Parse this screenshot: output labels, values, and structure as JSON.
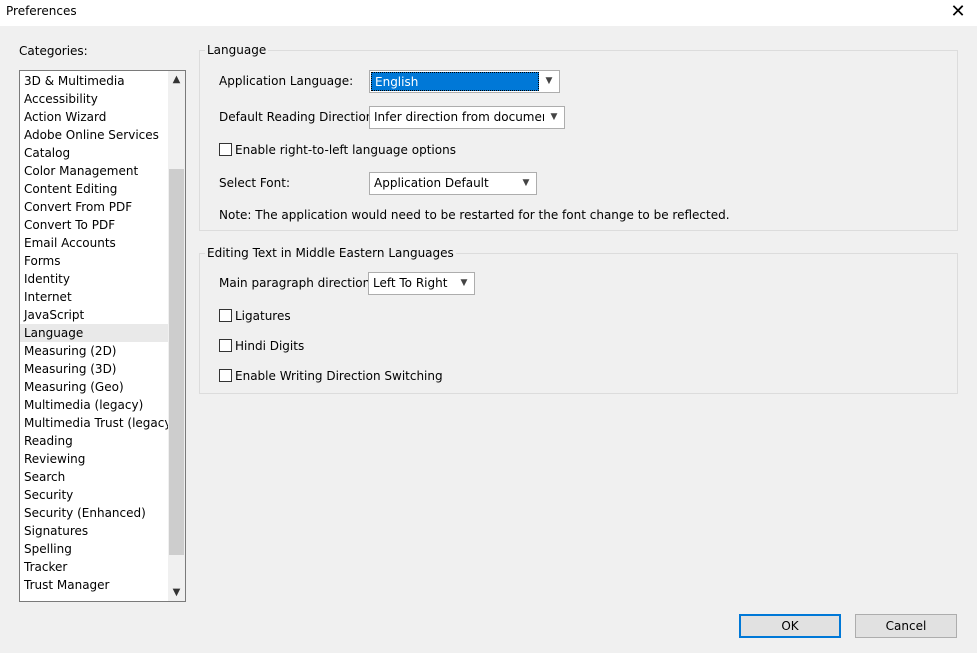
{
  "window": {
    "title": "Preferences",
    "close_glyph": "✕"
  },
  "categories": {
    "label": "Categories:",
    "items": [
      "3D & Multimedia",
      "Accessibility",
      "Action Wizard",
      "Adobe Online Services",
      "Catalog",
      "Color Management",
      "Content Editing",
      "Convert From PDF",
      "Convert To PDF",
      "Email Accounts",
      "Forms",
      "Identity",
      "Internet",
      "JavaScript",
      "Language",
      "Measuring (2D)",
      "Measuring (3D)",
      "Measuring (Geo)",
      "Multimedia (legacy)",
      "Multimedia Trust (legacy)",
      "Reading",
      "Reviewing",
      "Search",
      "Security",
      "Security (Enhanced)",
      "Signatures",
      "Spelling",
      "Tracker",
      "Trust Manager"
    ],
    "selected": "Language"
  },
  "language_group": {
    "title": "Language",
    "app_language_label": "Application Language:",
    "app_language_value": "English",
    "reading_direction_label": "Default Reading Direction:",
    "reading_direction_value": "Infer direction from document",
    "rtl_checkbox_label": "Enable right-to-left language options",
    "select_font_label": "Select Font:",
    "select_font_value": "Application Default",
    "note": "Note: The application would need to be restarted for the font change to be reflected."
  },
  "editing_group": {
    "title": "Editing Text in Middle Eastern Languages",
    "paragraph_direction_label": "Main paragraph direction:",
    "paragraph_direction_value": "Left To Right",
    "ligatures_label": "Ligatures",
    "hindi_digits_label": "Hindi Digits",
    "writing_direction_label": "Enable Writing Direction Switching"
  },
  "buttons": {
    "ok": "OK",
    "cancel": "Cancel"
  }
}
